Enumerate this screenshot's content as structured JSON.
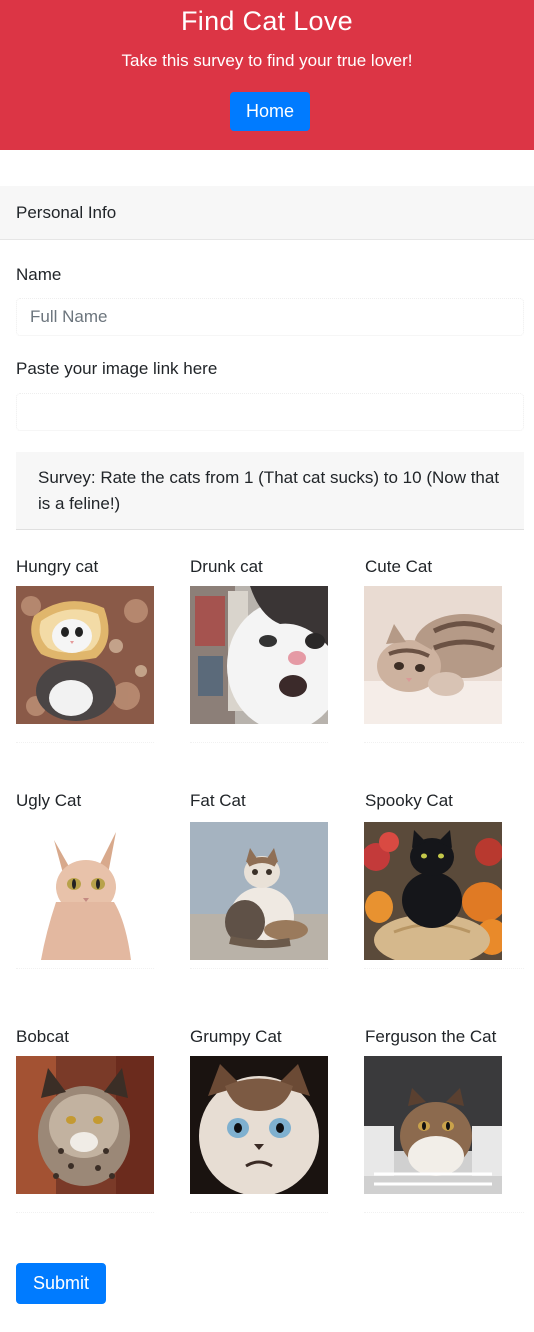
{
  "hero": {
    "title": "Find Cat Love",
    "subtitle": "Take this survey to find your true lover!",
    "home_button": "Home",
    "background_color": "#dc3545"
  },
  "personal_info": {
    "header": "Personal Info",
    "name_label": "Name",
    "name_placeholder": "Full Name",
    "image_label": "Paste your image link here",
    "image_placeholder": ""
  },
  "survey": {
    "instructions": "Survey: Rate the cats from 1 (That cat sucks) to 10 (Now that is a feline!)",
    "cats": [
      {
        "title": "Hungry cat",
        "image": "cat-in-bread-photo"
      },
      {
        "title": "Drunk cat",
        "image": "drunk-cat-photo"
      },
      {
        "title": "Cute Cat",
        "image": "cute-tabby-kitten-photo"
      },
      {
        "title": "Ugly Cat",
        "image": "sphynx-cat-photo"
      },
      {
        "title": "Fat Cat",
        "image": "fat-cat-sitting-photo"
      },
      {
        "title": "Spooky Cat",
        "image": "black-cat-on-pumpkin-photo"
      },
      {
        "title": "Bobcat",
        "image": "bobcat-photo"
      },
      {
        "title": "Grumpy Cat",
        "image": "grumpy-cat-photo"
      },
      {
        "title": "Ferguson the Cat",
        "image": "ferguson-cat-in-basket-photo"
      }
    ]
  },
  "submit_button": "Submit",
  "colors": {
    "primary": "#007bff",
    "danger": "#dc3545",
    "card_header_bg": "#f7f7f7"
  }
}
